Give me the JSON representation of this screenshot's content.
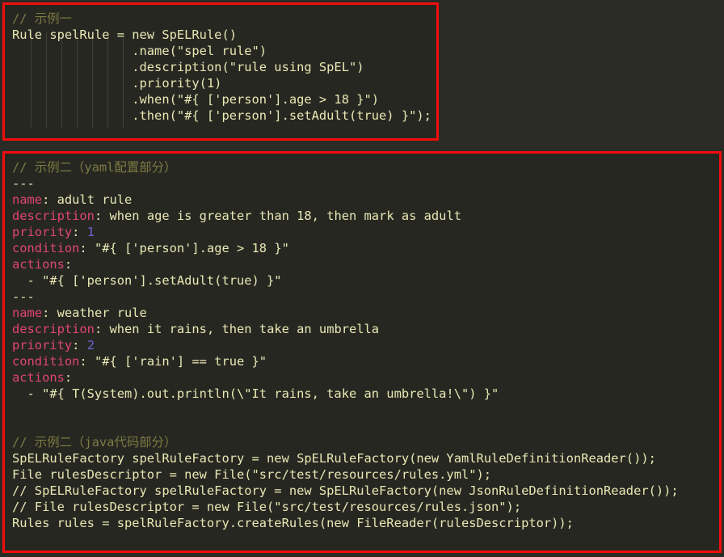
{
  "theme": {
    "page_background": "#2b2b26",
    "box_background": "#272722",
    "box_border": "#f20d0d",
    "code_foreground": "#e8e8b4",
    "comment_color": "#7b7b43",
    "yaml_key_color": "#e0466e",
    "number_color": "#6a64cf",
    "indent_guide_color": "#4a4a3f"
  },
  "boxes": [
    {
      "id": "example-one",
      "language": "java",
      "lines": [
        {
          "type": "comment",
          "text": "// 示例一"
        },
        {
          "type": "code",
          "text": "Rule spelRule = new SpELRule()"
        },
        {
          "type": "code",
          "text": "                .name(\"spel rule\")"
        },
        {
          "type": "code",
          "text": "                .description(\"rule using SpEL\")"
        },
        {
          "type": "code",
          "text": "                .priority(1)"
        },
        {
          "type": "code",
          "text": "                .when(\"#{ ['person'].age > 18 }\")"
        },
        {
          "type": "code",
          "text": "                .then(\"#{ ['person'].setAdult(true) }\");"
        }
      ]
    },
    {
      "id": "example-two",
      "language": "yaml+java",
      "yaml_section": {
        "comment": "// 示例二（yaml配置部分）",
        "documents": [
          {
            "separator": "---",
            "entries": [
              {
                "key": "name",
                "value": " adult rule",
                "value_type": "string"
              },
              {
                "key": "description",
                "value": " when age is greater than 18, then mark as adult",
                "value_type": "string"
              },
              {
                "key": "priority",
                "value": " 1",
                "value_type": "number"
              },
              {
                "key": "condition",
                "value": " \"#{ ['person'].age > 18 }\"",
                "value_type": "string"
              },
              {
                "key": "actions",
                "value": "",
                "value_type": "list"
              }
            ],
            "list_items": [
              "  - \"#{ ['person'].setAdult(true) }\""
            ]
          },
          {
            "separator": "---",
            "entries": [
              {
                "key": "name",
                "value": " weather rule",
                "value_type": "string"
              },
              {
                "key": "description",
                "value": " when it rains, then take an umbrella",
                "value_type": "string"
              },
              {
                "key": "priority",
                "value": " 2",
                "value_type": "number"
              },
              {
                "key": "condition",
                "value": " \"#{ ['rain'] == true }\"",
                "value_type": "string"
              },
              {
                "key": "actions",
                "value": "",
                "value_type": "list"
              }
            ],
            "list_items": [
              "  - \"#{ T(System).out.println(\\\"It rains, take an umbrella!\\\") }\""
            ]
          }
        ]
      },
      "java_section": {
        "comment": "// 示例二（java代码部分）",
        "lines": [
          "SpELRuleFactory spelRuleFactory = new SpELRuleFactory(new YamlRuleDefinitionReader());",
          "File rulesDescriptor = new File(\"src/test/resources/rules.yml\");",
          "// SpELRuleFactory spelRuleFactory = new SpELRuleFactory(new JsonRuleDefinitionReader());",
          "// File rulesDescriptor = new File(\"src/test/resources/rules.json\");",
          "Rules rules = spelRuleFactory.createRules(new FileReader(rulesDescriptor));"
        ]
      }
    }
  ],
  "indent_guides": {
    "count": 7,
    "x_positions": [
      32,
      51,
      70,
      89,
      108,
      127,
      146
    ]
  }
}
